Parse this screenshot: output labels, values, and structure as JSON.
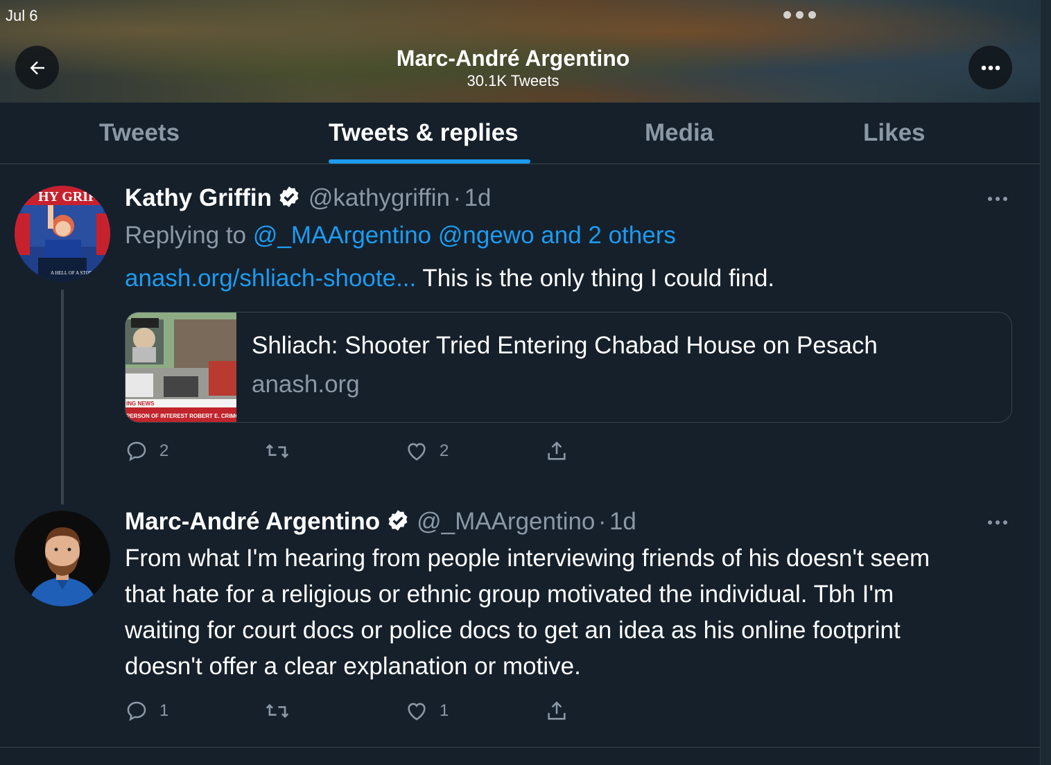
{
  "status_bar": {
    "date": "Jul 6"
  },
  "header": {
    "title": "Marc-André Argentino",
    "subtitle": "30.1K Tweets"
  },
  "tabs": [
    {
      "label": "Tweets",
      "active": false
    },
    {
      "label": "Tweets & replies",
      "active": true
    },
    {
      "label": "Media",
      "active": false
    },
    {
      "label": "Likes",
      "active": false
    }
  ],
  "tweets": [
    {
      "name": "Kathy Griffin",
      "handle": "@kathygriffin",
      "sep": "·",
      "time": "1d",
      "verified": true,
      "reply_prefix": "Replying to ",
      "reply_to": "@_MAArgentino @ngewo and 2 others",
      "link": "anash.org/shliach-shoote...",
      "text": " This is the only thing I could find.",
      "card": {
        "title": "Shliach: Shooter Tried Entering Chabad House on Pesach",
        "domain": "anash.org",
        "image_caption_1": "ING NEWS",
        "image_caption_2": "PERSON OF INTEREST ROBERT E. CRIMO"
      },
      "avatar_text": {
        "top": "HY GRIF",
        "bottom": "A HELL OF A STORY"
      },
      "actions": {
        "replies": "2",
        "retweets": "",
        "likes": "2"
      }
    },
    {
      "name": "Marc-André Argentino",
      "handle": "@_MAArgentino",
      "sep": "·",
      "time": "1d",
      "verified": true,
      "lines": [
        "From what I'm hearing from people interviewing friends of his doesn't seem",
        "that hate for a religious or ethnic group motivated the individual. Tbh I'm",
        "waiting for court docs or police docs to get an idea as his online footprint",
        "doesn't offer a clear explanation or motive."
      ],
      "actions": {
        "replies": "1",
        "retweets": "",
        "likes": "1"
      }
    }
  ],
  "icons": {
    "back": "arrow-left-icon",
    "more": "more-horizontal-icon",
    "verified": "verified-badge-icon",
    "reply": "reply-icon",
    "retweet": "retweet-icon",
    "like": "heart-icon",
    "share": "share-icon"
  },
  "colors": {
    "background": "#15202b",
    "accent": "#1d9bf0",
    "secondary_text": "#8b98a5",
    "border": "#38444d"
  }
}
